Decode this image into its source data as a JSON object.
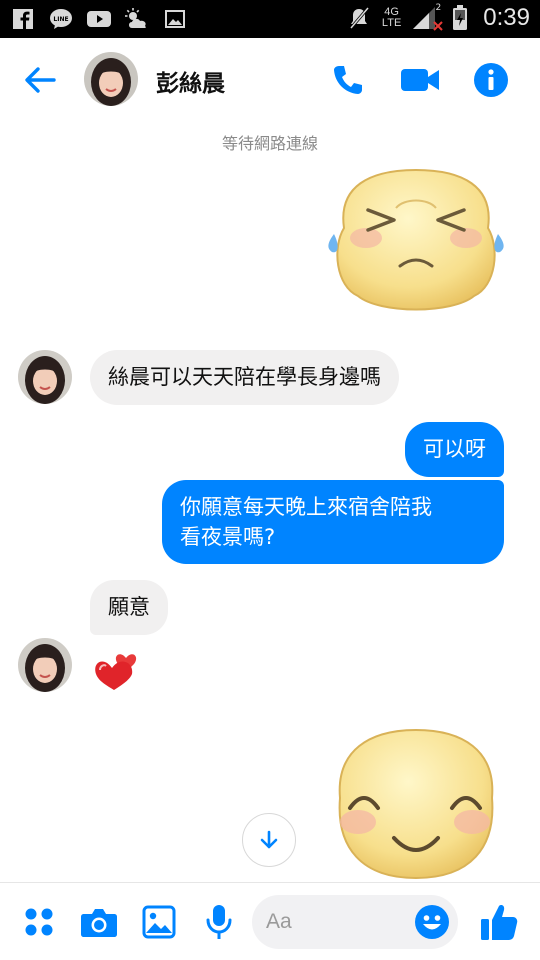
{
  "status_bar": {
    "time": "0:39",
    "network": "4G",
    "network_sub": "LTE",
    "sim_indicator": "2",
    "left_icons": [
      "facebook-icon",
      "line-icon",
      "youtube-icon",
      "weather-icon",
      "gallery-icon"
    ],
    "right_icons": [
      "mute-icon",
      "signal-icon",
      "battery-icon"
    ]
  },
  "header": {
    "contact_name": "彭絲晨",
    "icons": [
      "back-arrow-icon",
      "phone-icon",
      "video-camera-icon",
      "info-icon"
    ],
    "accent": "#0084ff"
  },
  "conversation": {
    "status": "等待網路連線",
    "messages": [
      {
        "from": "me",
        "type": "sticker",
        "name": "crying-face-sticker"
      },
      {
        "from": "contact",
        "type": "text",
        "text": "絲晨可以天天陪在學長身邊嗎"
      },
      {
        "from": "me",
        "type": "text",
        "text": "可以呀"
      },
      {
        "from": "me",
        "type": "text",
        "text": "你願意每天晚上來宿舍陪我看夜景嗎?"
      },
      {
        "from": "contact",
        "type": "text",
        "text": "願意"
      },
      {
        "from": "contact",
        "type": "emoji",
        "name": "two-hearts-emoji"
      },
      {
        "from": "me",
        "type": "sticker",
        "name": "smiling-face-sticker"
      }
    ],
    "message2_line1": "你願意每天晚上來宿舍陪我",
    "message2_line2": "看夜景嗎?",
    "incoming_bubble_color": "#f1f0f0",
    "outgoing_bubble_color": "#0084ff"
  },
  "composer": {
    "placeholder": "Aa",
    "icons": [
      "apps-grid-icon",
      "camera-icon",
      "image-icon",
      "microphone-icon",
      "emoji-icon",
      "thumbs-up-icon"
    ]
  }
}
